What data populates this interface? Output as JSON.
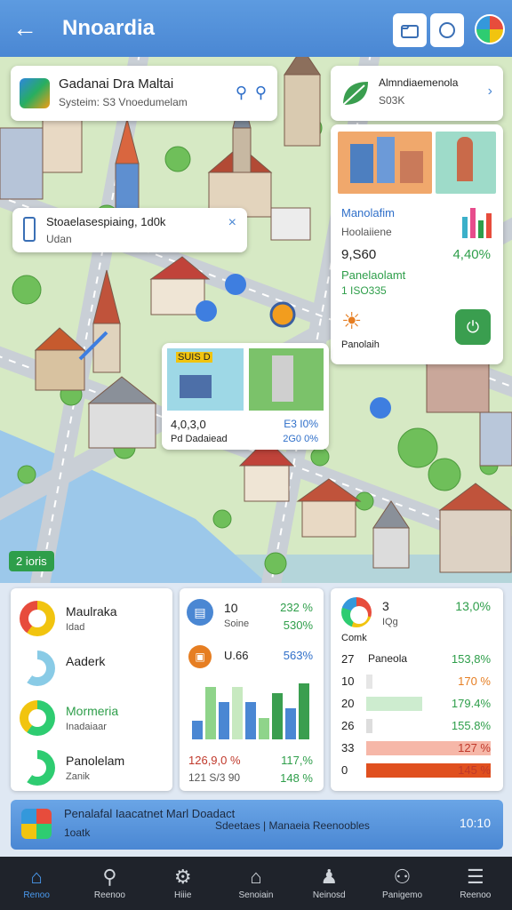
{
  "header": {
    "title": "Nnoardia",
    "back_icon": "←"
  },
  "search_card": {
    "title": "Gadanai Dra Maltai",
    "subtitle": "Systeim: S3 Vnoedumelam"
  },
  "top_right_card": {
    "title": "Almndiaemenola",
    "sub": "S03K"
  },
  "info_popup": {
    "title": "Stoaelasespiaing, 1d0k",
    "sub": "Udan"
  },
  "right_panel": {
    "label1": "Manolafim",
    "label2": "Hoolaiiene",
    "value1": "9,S60",
    "value2": "4,40%",
    "label3": "Panelaolamt",
    "value3": "1 ISO335",
    "label4": "Panolaih"
  },
  "center_card": {
    "label": "SUIS D",
    "v1": "4,0,3,0",
    "v2": "E3 I0%",
    "v3": "Pd Dadaiead",
    "v4": "2G0 0%"
  },
  "map_badge": "2 ioris",
  "panel_left": [
    {
      "label": "Maulraka",
      "sub": "Idad",
      "color": "#f1c40f",
      "c2": "#e74c3c"
    },
    {
      "label": "Aaderk",
      "sub": "",
      "color": "#89cbe6",
      "c2": "#ffffff"
    },
    {
      "label": "Mormeria",
      "sub": "Inadaiaar",
      "color": "#2ecc71",
      "c2": "#f1c40f"
    },
    {
      "label": "Panolelam",
      "sub": "Zanik",
      "color": "#2ecc71",
      "c2": "#ffffff"
    }
  ],
  "panel_mid": {
    "r1a": "10",
    "r1b": "Soine",
    "r1c": "232 %",
    "r1d": "530%",
    "r2a": "U.66",
    "r2b": "563%",
    "foot1": "126,9,0 %",
    "foot2": "117,%",
    "foot3": "121 S/3 90",
    "foot4": "148 %",
    "bars": [
      0.3,
      0.85,
      0.6,
      0.85,
      0.6,
      0.35,
      0.75,
      0.5,
      0.9
    ]
  },
  "panel_right": {
    "top": "3",
    "topsub": "IQg",
    "topval": "13,0%",
    "head": "Comk",
    "rows": [
      {
        "k": "27",
        "l": "Paneola",
        "v": "153,8%",
        "fill": 0,
        "color": "#ffffff",
        "vcolor": "#2e9e4a"
      },
      {
        "k": "10",
        "l": "",
        "v": "170 %",
        "fill": 0.05,
        "color": "#e6e6e6",
        "vcolor": "#e67e22"
      },
      {
        "k": "20",
        "l": "",
        "v": "179.4%",
        "fill": 0.45,
        "color": "#cdeccf",
        "vcolor": "#2e9e4a"
      },
      {
        "k": "26",
        "l": "",
        "v": "155.8%",
        "fill": 0.05,
        "color": "#dddddd",
        "vcolor": "#2e9e4a"
      },
      {
        "k": "33",
        "l": "",
        "v": "127 %",
        "fill": 1,
        "color": "#f6b7a8",
        "vcolor": "#c0392b"
      },
      {
        "k": "0",
        "l": "",
        "v": "145 %",
        "fill": 1,
        "color": "#e0501f",
        "vcolor": "#c0392b"
      }
    ]
  },
  "footer_bar": {
    "title": "Penalafal Iaacatnet Marl Doadact",
    "sub1": "1oatk",
    "sub2": "Sdeetaes | Manaeia Reenoobles",
    "time": "10:10"
  },
  "nav": [
    {
      "label": "Renoo",
      "icon": "⌂"
    },
    {
      "label": "Reenoo",
      "icon": "⚲"
    },
    {
      "label": "Hiiie",
      "icon": "⚙"
    },
    {
      "label": "Senoiain",
      "icon": "⌂"
    },
    {
      "label": "Neinosd",
      "icon": "♟"
    },
    {
      "label": "Panigemo",
      "icon": "⚇"
    },
    {
      "label": "Reenoo",
      "icon": "☰"
    }
  ],
  "colors": {
    "brand": "#4a87d3",
    "water": "#9cc8ea",
    "road": "#c9cfd6",
    "grass": "#bfe0a6"
  }
}
